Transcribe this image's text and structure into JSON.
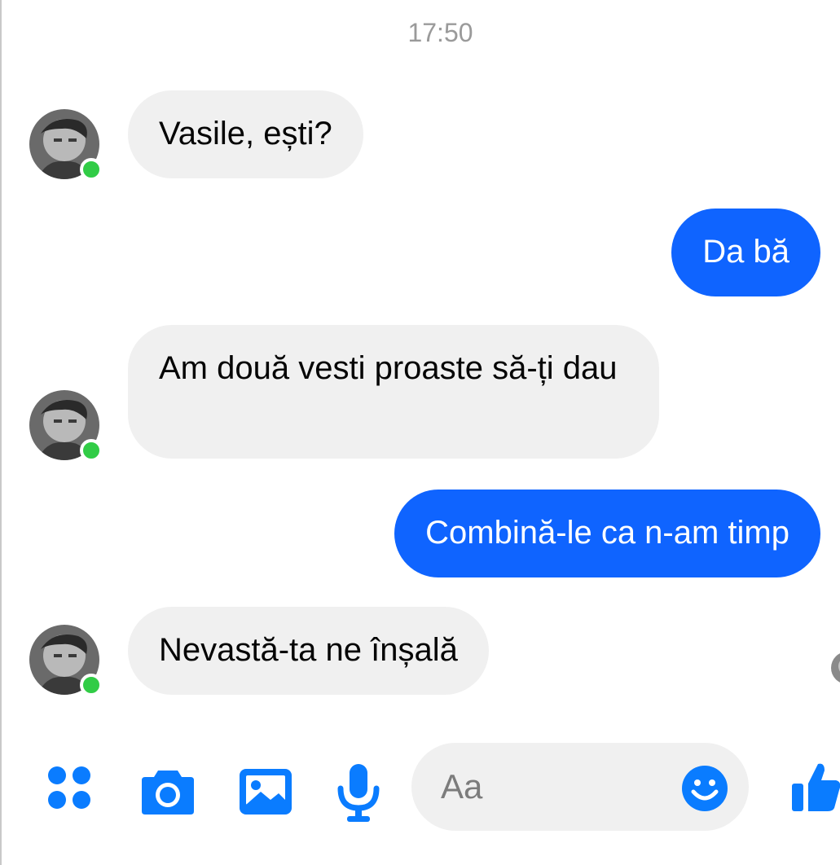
{
  "timestamp": "17:50",
  "contact": {
    "avatar_icon": "contact-avatar-photo",
    "presence_color": "#31cc46"
  },
  "messages": [
    {
      "direction": "incoming",
      "text": "Vasile, ești?"
    },
    {
      "direction": "outgoing",
      "text": "Da bă"
    },
    {
      "direction": "incoming",
      "text": "Am două vesti proaste să-ți dau"
    },
    {
      "direction": "outgoing",
      "text": "Combină-le ca n-am timp"
    },
    {
      "direction": "incoming",
      "text": "Nevastă-ta ne înșală"
    }
  ],
  "composer": {
    "placeholder": "Aa",
    "tools": [
      "more-icon",
      "camera-icon",
      "gallery-icon",
      "microphone-icon"
    ],
    "emoji_icon": "emoji-icon",
    "send_icon": "like-thumbs-up-icon"
  },
  "colors": {
    "accent": "#0f64ff",
    "incoming_bubble": "#f0f0f0",
    "icon_blue": "#0a7cff"
  }
}
